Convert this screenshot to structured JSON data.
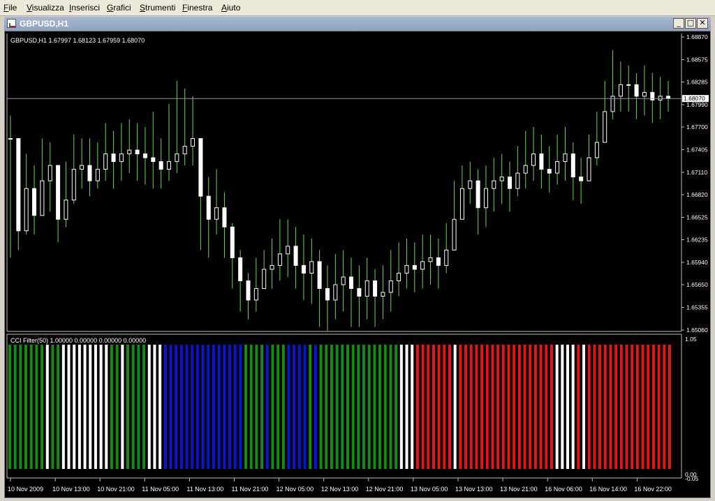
{
  "menu": [
    "File",
    "Visualizza",
    "Inserisci",
    "Grafici",
    "Strumenti",
    "Finestra",
    "Aiuto"
  ],
  "window": {
    "title": "GBPUSD,H1"
  },
  "window_controls": {
    "minimize": "_",
    "restore": "□",
    "close": "✕"
  },
  "price_panel": {
    "label": "GBPUSD,H1  1.67997 1.68123 1.67959 1.68070",
    "current_price": "1.68070",
    "axis_ticks": [
      "1.68870",
      "1.68575",
      "1.68285",
      "1.67990",
      "1.67700",
      "1.67405",
      "1.67110",
      "1.66820",
      "1.66525",
      "1.66235",
      "1.65940",
      "1.65650",
      "1.65355",
      "1.65060"
    ]
  },
  "indicator_panel": {
    "label": "CCI Filter(50) 1.00000 0.00000 0.00000 0.00000",
    "axis_top": "1.05",
    "axis_bottom_a": "0.00",
    "axis_bottom_b": "-0.05"
  },
  "time_axis": [
    "10 Nov 2009",
    "10 Nov 13:00",
    "10 Nov 21:00",
    "11 Nov 05:00",
    "11 Nov 13:00",
    "11 Nov 21:00",
    "12 Nov 05:00",
    "12 Nov 13:00",
    "12 Nov 21:00",
    "13 Nov 05:00",
    "13 Nov 13:00",
    "13 Nov 21:00",
    "16 Nov 06:00",
    "16 Nov 14:00",
    "16 Nov 22:00"
  ],
  "colors": {
    "candle": "#ffffff",
    "wick": "#66dd44",
    "green": "#148c14",
    "white": "#ffffff",
    "blue": "#0a14d2",
    "red": "#e61414",
    "grid_line": "#8a9aa8",
    "background": "#000000"
  },
  "chart_data": [
    {
      "type": "candlestick",
      "title": "GBPUSD,H1",
      "ylim": [
        1.6506,
        1.6887
      ],
      "close": [
        1.6755,
        1.6635,
        1.669,
        1.6655,
        1.67,
        1.672,
        1.665,
        1.6675,
        1.6715,
        1.672,
        1.67,
        1.6715,
        1.6735,
        1.6725,
        1.6735,
        1.674,
        1.6735,
        1.673,
        1.6725,
        1.6715,
        1.6725,
        1.6735,
        1.6745,
        1.6755,
        1.668,
        1.665,
        1.6665,
        1.664,
        1.66,
        1.657,
        1.6545,
        1.656,
        1.6585,
        1.659,
        1.6605,
        1.6615,
        1.659,
        1.658,
        1.6595,
        1.656,
        1.6545,
        1.6565,
        1.6575,
        1.656,
        1.655,
        1.657,
        1.655,
        1.6555,
        1.657,
        1.658,
        1.659,
        1.6585,
        1.6595,
        1.66,
        1.659,
        1.661,
        1.665,
        1.669,
        1.67,
        1.6665,
        1.669,
        1.67,
        1.6705,
        1.669,
        1.671,
        1.672,
        1.6735,
        1.6715,
        1.671,
        1.6725,
        1.6735,
        1.6705,
        1.67,
        1.673,
        1.675,
        1.679,
        1.681,
        1.6825,
        1.6825,
        1.681,
        1.6815,
        1.6805,
        1.681,
        1.6807
      ],
      "wick_high": [
        1.6785,
        1.671,
        1.6735,
        1.672,
        1.6755,
        1.675,
        1.672,
        1.6725,
        1.676,
        1.6755,
        1.6755,
        1.675,
        1.6775,
        1.6765,
        1.6775,
        1.678,
        1.6775,
        1.677,
        1.679,
        1.6755,
        1.68,
        1.683,
        1.682,
        1.681,
        1.6735,
        1.6705,
        1.6715,
        1.6685,
        1.6645,
        1.661,
        1.658,
        1.66,
        1.661,
        1.6625,
        1.665,
        1.665,
        1.664,
        1.663,
        1.6625,
        1.661,
        1.659,
        1.6605,
        1.661,
        1.66,
        1.659,
        1.66,
        1.6585,
        1.659,
        1.661,
        1.662,
        1.6625,
        1.662,
        1.663,
        1.663,
        1.6625,
        1.6645,
        1.67,
        1.672,
        1.6725,
        1.6715,
        1.672,
        1.673,
        1.6735,
        1.6725,
        1.6745,
        1.6765,
        1.677,
        1.676,
        1.6745,
        1.676,
        1.677,
        1.675,
        1.673,
        1.676,
        1.679,
        1.683,
        1.687,
        1.6855,
        1.685,
        1.684,
        1.685,
        1.684,
        1.6835,
        1.683
      ],
      "wick_low": [
        1.66,
        1.661,
        1.663,
        1.663,
        1.666,
        1.666,
        1.662,
        1.664,
        1.667,
        1.669,
        1.668,
        1.669,
        1.67,
        1.669,
        1.67,
        1.671,
        1.67,
        1.6695,
        1.669,
        1.669,
        1.67,
        1.671,
        1.672,
        1.672,
        1.661,
        1.66,
        1.663,
        1.66,
        1.656,
        1.653,
        1.652,
        1.653,
        1.656,
        1.656,
        1.657,
        1.6575,
        1.656,
        1.6545,
        1.654,
        1.651,
        1.6505,
        1.652,
        1.653,
        1.651,
        1.651,
        1.652,
        1.651,
        1.652,
        1.653,
        1.655,
        1.656,
        1.6555,
        1.656,
        1.6565,
        1.656,
        1.658,
        1.661,
        1.665,
        1.667,
        1.663,
        1.664,
        1.666,
        1.667,
        1.666,
        1.668,
        1.669,
        1.67,
        1.669,
        1.6685,
        1.6695,
        1.67,
        1.6675,
        1.667,
        1.67,
        1.672,
        1.676,
        1.678,
        1.679,
        1.679,
        1.678,
        1.6785,
        1.6775,
        1.678,
        1.679
      ],
      "current": 1.6807
    },
    {
      "type": "bar",
      "title": "CCI Filter(50)",
      "ylim": [
        -0.05,
        1.05
      ],
      "bar_value": 1.0,
      "bar_colors": [
        "green",
        "green",
        "green",
        "green",
        "green",
        "green",
        "green",
        "white",
        "green",
        "green",
        "white",
        "white",
        "white",
        "white",
        "white",
        "white",
        "white",
        "white",
        "white",
        "green",
        "green",
        "white",
        "green",
        "green",
        "green",
        "green",
        "white",
        "white",
        "white",
        "blue",
        "blue",
        "blue",
        "blue",
        "blue",
        "blue",
        "blue",
        "blue",
        "blue",
        "blue",
        "blue",
        "blue",
        "blue",
        "blue",
        "blue",
        "green",
        "green",
        "green",
        "green",
        "blue",
        "green",
        "green",
        "green",
        "blue",
        "blue",
        "blue",
        "blue",
        "green",
        "blue",
        "green",
        "green",
        "green",
        "green",
        "green",
        "green",
        "green",
        "green",
        "green",
        "green",
        "green",
        "green",
        "green",
        "green",
        "green",
        "white",
        "white",
        "white",
        "red",
        "red",
        "red",
        "red",
        "red",
        "red",
        "red",
        "white",
        "red",
        "red",
        "red",
        "red",
        "red",
        "red",
        "red",
        "red",
        "red",
        "red",
        "red",
        "red",
        "red",
        "red",
        "red",
        "red",
        "red",
        "red",
        "white",
        "white",
        "white",
        "white",
        "red",
        "white",
        "red",
        "red",
        "red",
        "red",
        "red",
        "red",
        "red",
        "red",
        "red",
        "red",
        "red",
        "red",
        "red",
        "red",
        "red",
        "red"
      ]
    }
  ]
}
